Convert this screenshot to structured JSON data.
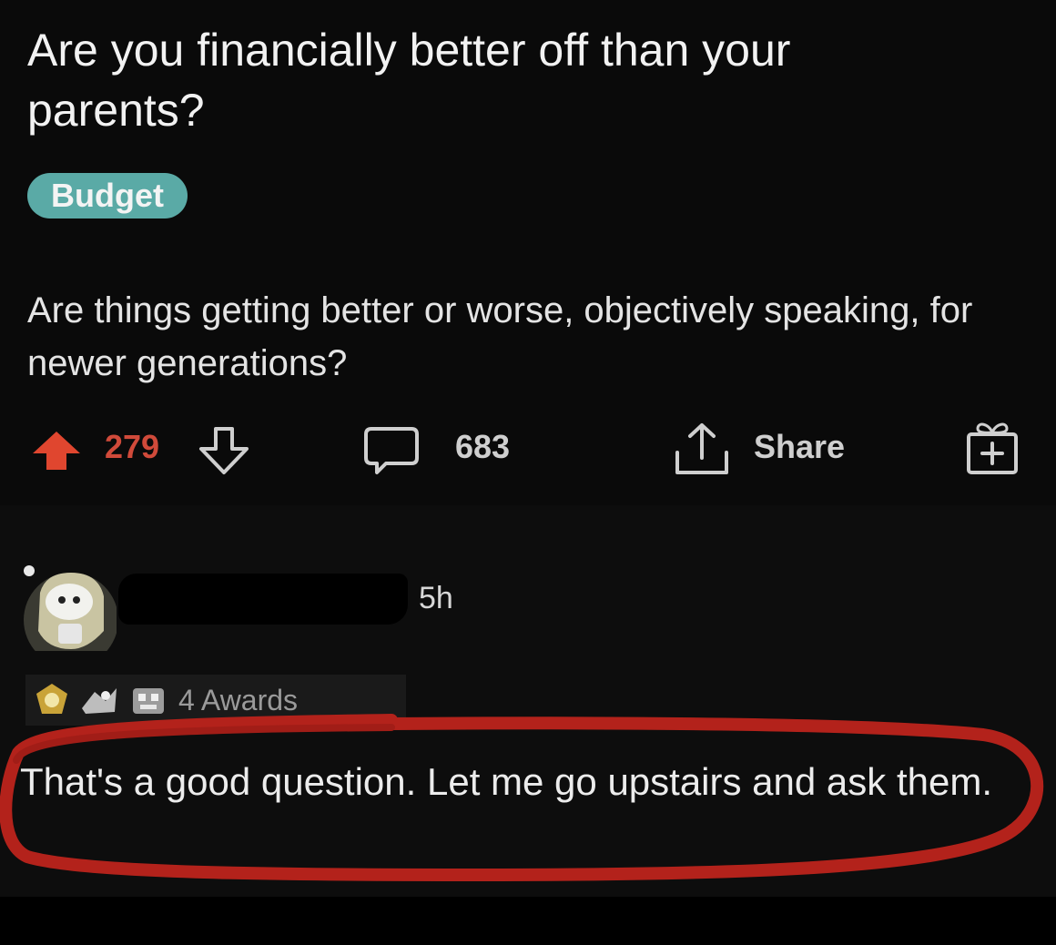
{
  "post": {
    "title": "Are you financially better off than your parents?",
    "flair": "Budget",
    "body": "Are things getting better or worse, objectively speaking, for newer generations?"
  },
  "actions": {
    "upvotes": "279",
    "comments": "683",
    "share_label": "Share",
    "icons": [
      "upvote-icon",
      "downvote-icon",
      "comment-icon",
      "share-icon",
      "gift-icon"
    ]
  },
  "comment": {
    "timestamp": "5h",
    "awards_label": "4 Awards",
    "text": "That's a good question. Let me go upstairs and ask them."
  },
  "colors": {
    "background": "#0a0a0a",
    "flair": "#5aaaa6",
    "upvote": "#e0462f",
    "annotation": "#b3221b"
  }
}
